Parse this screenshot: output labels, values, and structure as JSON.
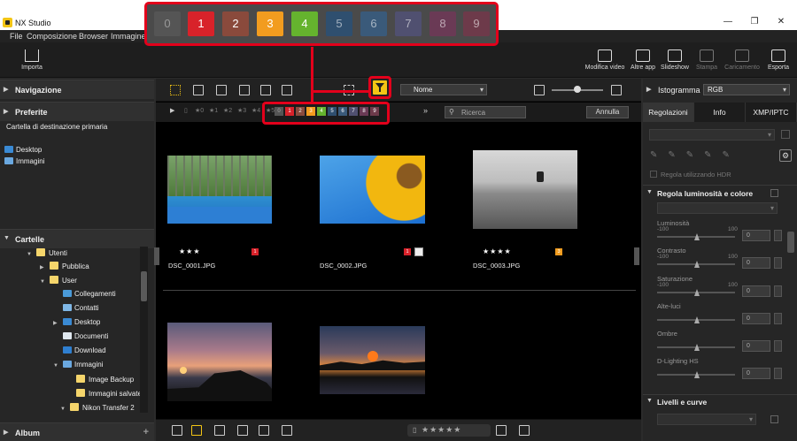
{
  "window": {
    "title": "NX Studio"
  },
  "menu": [
    "File",
    "Composizione",
    "Browser",
    "Immagine"
  ],
  "toolbar": {
    "import": "Importa",
    "right_buttons": [
      "Modifica video",
      "Altre app",
      "Slideshow",
      "Stampa",
      "Caricamento",
      "Esporta"
    ]
  },
  "left": {
    "nav": "Navigazione",
    "fav": "Preferite",
    "fav_items": [
      "Cartella di destinazione primaria"
    ],
    "places": [
      "Desktop",
      "Immagini"
    ],
    "folders": "Cartelle",
    "tree": [
      "Utenti",
      "Pubblica",
      "User",
      "Collegamenti",
      "Contatti",
      "Desktop",
      "Documenti",
      "Download",
      "Immagini",
      "Image Backup",
      "Immagini salvate",
      "Nikon Transfer 2"
    ],
    "album": "Album"
  },
  "center": {
    "sort": "Nome",
    "search_placeholder": "Ricerca",
    "cancel": "Annulla",
    "label_filter": [
      "0",
      "1",
      "2",
      "3",
      "4",
      "5",
      "6",
      "7",
      "8",
      "9"
    ],
    "rating_filter": [
      "★0",
      "★1",
      "★2",
      "★3",
      "★4",
      "★5"
    ],
    "images": [
      {
        "name": "DSC_0001.JPG",
        "stars": "★★★",
        "label": "1"
      },
      {
        "name": "DSC_0002.JPG",
        "stars": "",
        "label": "1"
      },
      {
        "name": "DSC_0003.JPG",
        "stars": "★★★★",
        "label": "3"
      }
    ],
    "bottom_stars": "★★★★★"
  },
  "callout": {
    "labels": [
      "0",
      "1",
      "2",
      "3",
      "4",
      "5",
      "6",
      "7",
      "8",
      "9"
    ]
  },
  "colors": {
    "l0": "#555555",
    "l1": "#d8222a",
    "l2": "#8a4a3c",
    "l3": "#f29c1f",
    "l4": "#65b32e",
    "l5": "#2f4f6f",
    "l6": "#3a5a7a",
    "l7": "#505070",
    "l8": "#6a3a55",
    "l9": "#6d3a4a"
  },
  "right": {
    "histogram": "Istogramma",
    "histogram_channel": "RGB",
    "tabs": [
      "Regolazioni",
      "Info",
      "XMP/IPTC"
    ],
    "hdr": "Regola utilizzando HDR",
    "section": "Regola luminosità e colore",
    "sliders": [
      {
        "name": "Luminosità",
        "min": "-100",
        "max": "100",
        "value": "0"
      },
      {
        "name": "Contrasto",
        "min": "-100",
        "max": "100",
        "value": "0"
      },
      {
        "name": "Saturazione",
        "min": "-100",
        "max": "100",
        "value": "0"
      },
      {
        "name": "Alte-luci",
        "min": "",
        "max": "",
        "value": "0"
      },
      {
        "name": "Ombre",
        "min": "",
        "max": "",
        "value": "0"
      },
      {
        "name": "D-Lighting HS",
        "min": "",
        "max": "",
        "value": "0"
      }
    ],
    "levels": "Livelli e curve"
  }
}
